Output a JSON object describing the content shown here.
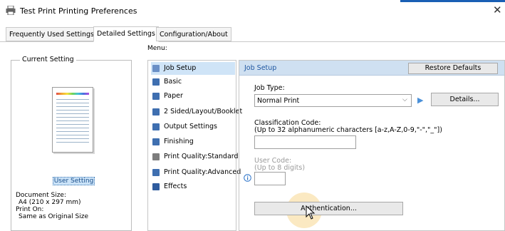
{
  "window": {
    "title": "Test Print Printing Preferences",
    "close_glyph": "✕"
  },
  "tabs": [
    {
      "label": "Frequently Used Settings",
      "active": false
    },
    {
      "label": "Detailed Settings",
      "active": true
    },
    {
      "label": "Configuration/About",
      "active": false
    }
  ],
  "current_setting": {
    "group_label": "Current Setting",
    "profile_label": "User Setting",
    "document_size_label": "Document Size:",
    "document_size_value": "A4 (210 x 297 mm)",
    "print_on_label": "Print On:",
    "print_on_value": "Same as Original Size"
  },
  "menu": {
    "label": "Menu:",
    "items": [
      {
        "label": "Job Setup",
        "icon": "job-setup-icon",
        "color": "#6a8fc6",
        "selected": true
      },
      {
        "label": "Basic",
        "icon": "basic-icon",
        "color": "#3f6fb0",
        "selected": false
      },
      {
        "label": "Paper",
        "icon": "paper-icon",
        "color": "#3f6fb0",
        "selected": false
      },
      {
        "label": "2 Sided/Layout/Booklet",
        "icon": "layout-icon",
        "color": "#3f6fb0",
        "selected": false
      },
      {
        "label": "Output Settings",
        "icon": "output-icon",
        "color": "#3f6fb0",
        "selected": false
      },
      {
        "label": "Finishing",
        "icon": "finishing-icon",
        "color": "#3f6fb0",
        "selected": false
      },
      {
        "label": "Print Quality:Standard",
        "icon": "print-quality-icon",
        "color": "#7d7d7d",
        "selected": false
      },
      {
        "label": "Print Quality:Advanced",
        "icon": "print-quality-advanced-icon",
        "color": "#3f6fb0",
        "selected": false
      },
      {
        "label": "Effects",
        "icon": "effects-icon",
        "color": "#2f5c9e",
        "selected": false
      }
    ]
  },
  "job_setup": {
    "title": "Job Setup",
    "restore_defaults": "Restore Defaults",
    "job_type_label": "Job Type:",
    "job_type_value": "Normal Print",
    "details_button": "Details...",
    "classification_label": "Classification Code:",
    "classification_hint": "(Up to 32 alphanumeric characters [a-z,A-Z,0-9,\"-\",\"_\"])",
    "classification_value": "",
    "user_code_label": "User Code:",
    "user_code_hint": "(Up to 8 digits)",
    "user_code_value": "",
    "authentication_button": "Authentication..."
  },
  "colors": {
    "accent": "#1f56a0",
    "header_bg": "#cfe0f1",
    "selection": "#cfe4f7"
  }
}
